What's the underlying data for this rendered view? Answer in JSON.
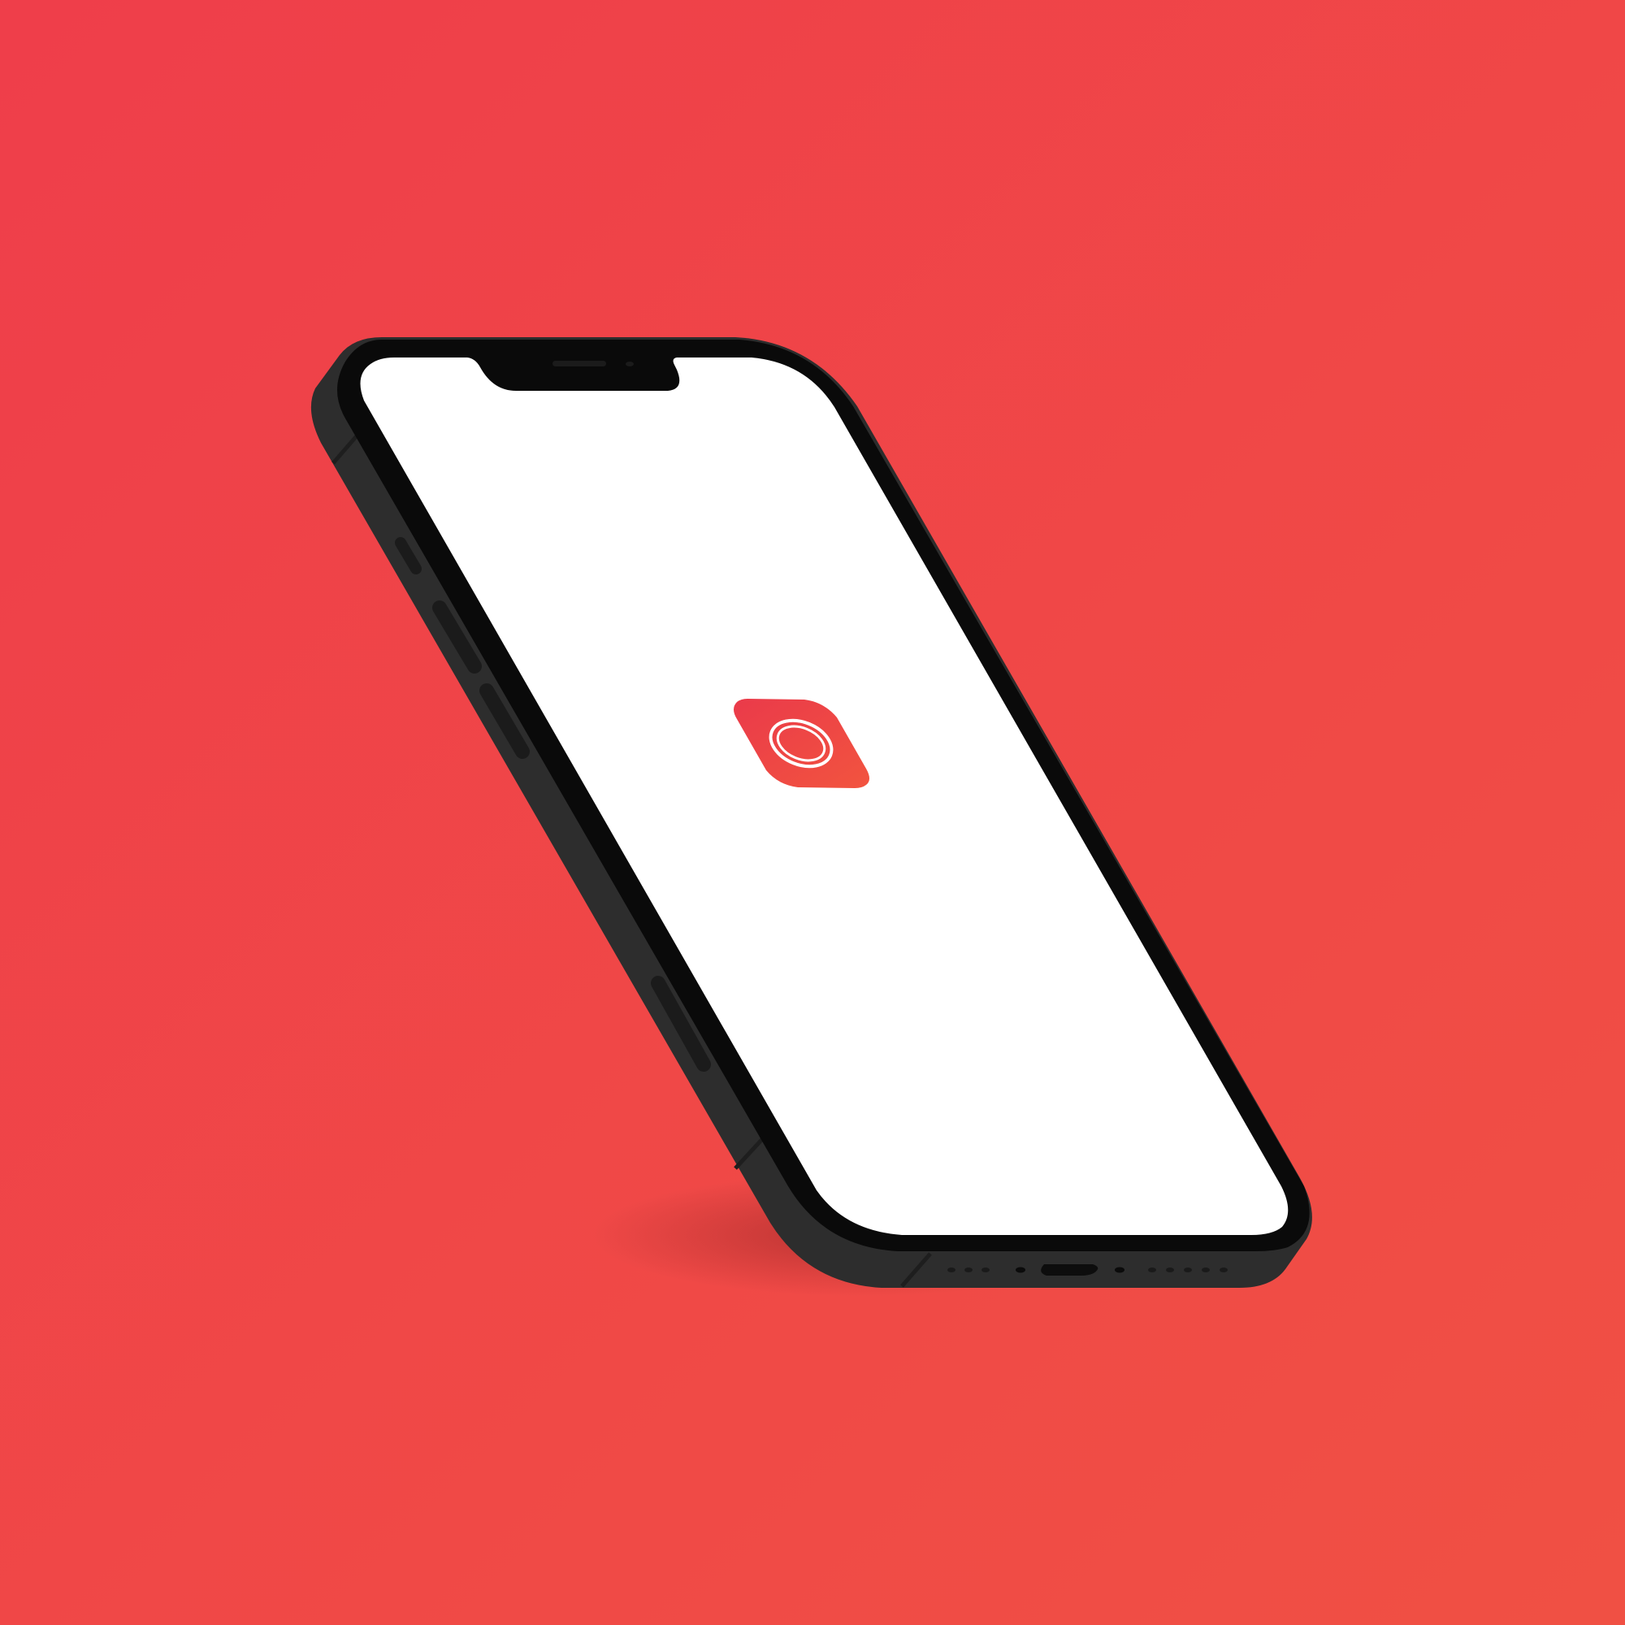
{
  "scene": {
    "subject": "phone-mockup",
    "orientation": "isometric-tilt"
  },
  "colors": {
    "background_top": "#ef3e4a",
    "background_bottom": "#f05044",
    "phone_body": "#2d2d2d",
    "phone_bezel": "#0a0a0a",
    "screen": "#ffffff",
    "app_icon_start": "#ea3a4a",
    "app_icon_end": "#f2543f"
  },
  "screen": {
    "content": "splash",
    "app_icon": "app-logo-icon"
  }
}
